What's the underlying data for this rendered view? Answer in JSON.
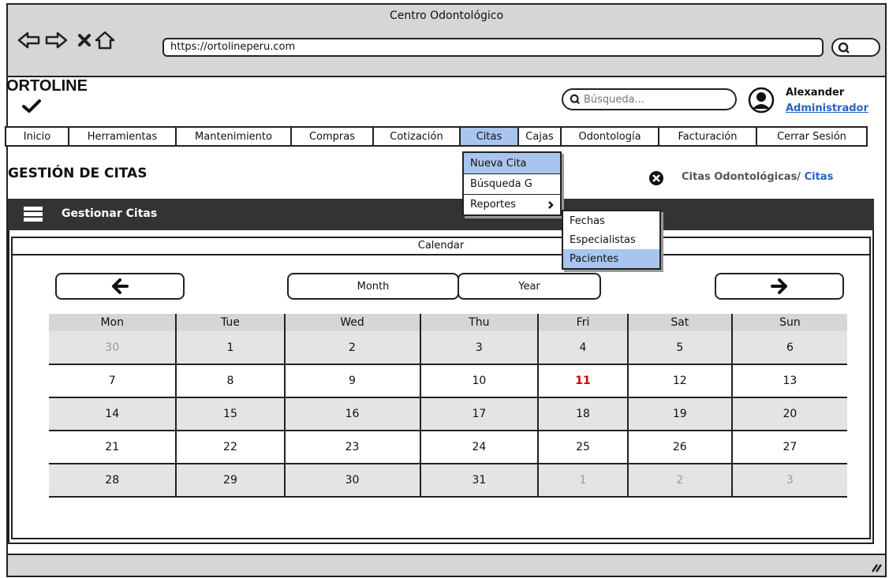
{
  "browser": {
    "window_title": "Centro Odontológico",
    "url": "https://ortolineperu.com"
  },
  "header": {
    "logo": "ORTOLINE",
    "search_placeholder": "Búsqueda...",
    "user_name": "Alexander",
    "user_role": "Administrador"
  },
  "menu": {
    "items": [
      {
        "label": "Inicio"
      },
      {
        "label": "Herramientas"
      },
      {
        "label": "Mantenimiento"
      },
      {
        "label": "Compras"
      },
      {
        "label": "Cotización"
      },
      {
        "label": "Citas"
      },
      {
        "label": "Cajas"
      },
      {
        "label": "Odontología"
      },
      {
        "label": "Facturación"
      },
      {
        "label": "Cerrar Sesión"
      }
    ],
    "active": "Citas"
  },
  "citas_menu": {
    "items": [
      {
        "label": "Nueva Cita"
      },
      {
        "label": "Búsqueda G"
      },
      {
        "label": "Reportes"
      }
    ]
  },
  "reportes_menu": {
    "items": [
      {
        "label": "Fechas"
      },
      {
        "label": "Especialistas"
      },
      {
        "label": "Pacientes"
      }
    ]
  },
  "page": {
    "title": "GESTIÓN DE CITAS",
    "breadcrumb_parent": "Citas Odontológicas/",
    "breadcrumb_current": "Citas"
  },
  "panel": {
    "title": "Gestionar Citas",
    "calendar_caption": "Calendar",
    "month_label": "Month",
    "year_label": "Year"
  },
  "calendar": {
    "weekdays": [
      "Mon",
      "Tue",
      "Wed",
      "Thu",
      "Fri",
      "Sat",
      "Sun"
    ],
    "weeks": [
      [
        "30",
        "1",
        "2",
        "3",
        "4",
        "5",
        "6"
      ],
      [
        "7",
        "8",
        "9",
        "10",
        "11",
        "12",
        "13"
      ],
      [
        "14",
        "15",
        "16",
        "17",
        "18",
        "19",
        "20"
      ],
      [
        "21",
        "22",
        "23",
        "24",
        "25",
        "26",
        "27"
      ],
      [
        "28",
        "29",
        "30",
        "31",
        "1",
        "2",
        "3"
      ]
    ],
    "today": "11",
    "colors": {
      "today": "#d10000",
      "muted": "#9a9a9a",
      "highlight": "#a9c5ee",
      "link": "#2563c9"
    }
  }
}
